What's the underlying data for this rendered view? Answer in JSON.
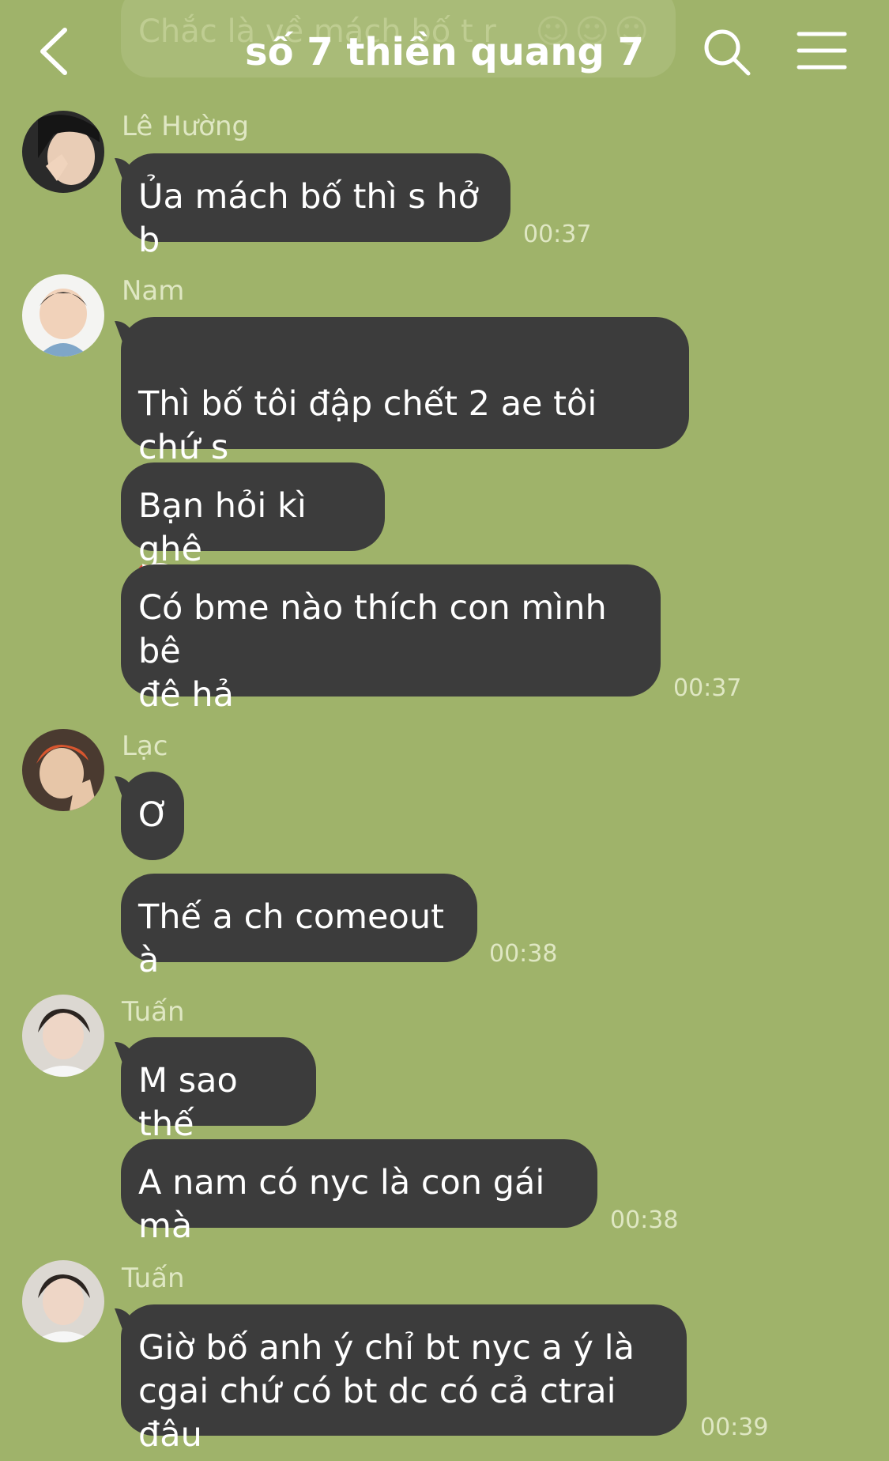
{
  "header": {
    "title": "số 7 thiền quang 7",
    "ghost_preview": "Chắc là về mách bố t r"
  },
  "icons": {
    "back": "chevron-left-icon",
    "search": "search-icon",
    "menu": "hamburger-menu-icon"
  },
  "colors": {
    "background": "#9fb36a",
    "bubble": "#3c3c3c",
    "meta_text": "#dfe7c3"
  },
  "messages": [
    {
      "sender": "Lê Hường",
      "bubbles": [
        "Ủa mách bố thì s hở b"
      ],
      "time": "00:37"
    },
    {
      "sender": "Nam",
      "bubbles": [
        "Thì bố tôi đập chết 2 ae tôi chứ s",
        "Bạn hỏi kì ghê",
        "Có bme nào thích con mình bê\nđê hả"
      ],
      "time": "00:37",
      "emoji": "clown-face-icon"
    },
    {
      "sender": "Lạc",
      "bubbles": [
        "Ơ",
        "Thế a ch comeout à"
      ],
      "time": "00:38"
    },
    {
      "sender": "Tuấn",
      "bubbles": [
        "M sao thế",
        "A nam có nyc là con gái mà"
      ],
      "time": "00:38"
    },
    {
      "sender": "Tuấn",
      "bubbles": [
        "Giờ bố anh ý chỉ bt nyc a ý là\ncgai chứ có bt dc có cả ctrai đâu"
      ],
      "time": "00:39"
    }
  ]
}
